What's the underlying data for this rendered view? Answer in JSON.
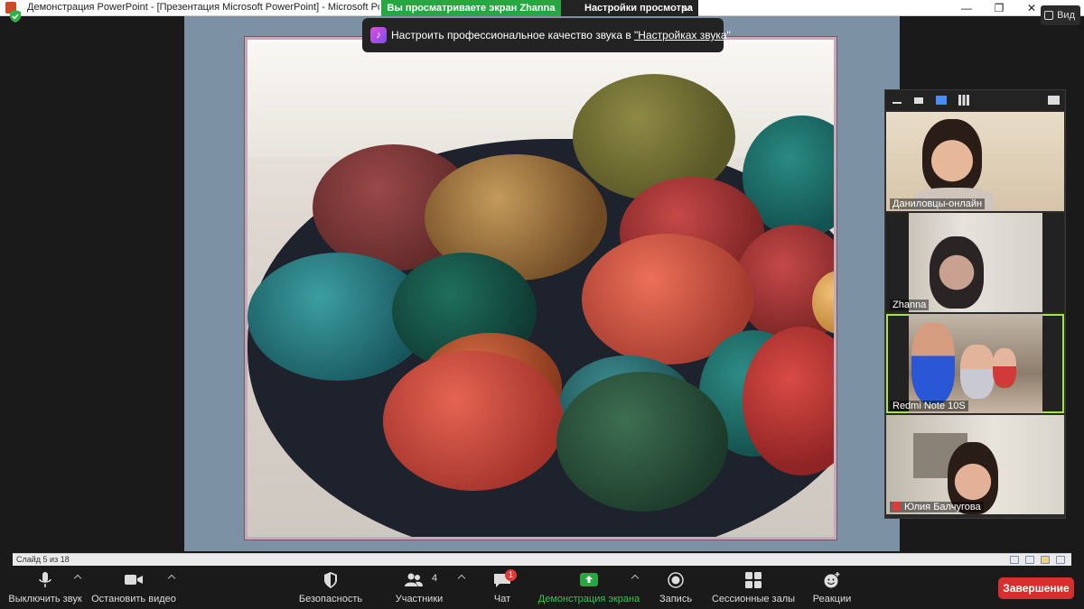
{
  "window": {
    "title": "Демонстрация PowerPoint - [Презентация Microsoft PowerPoint] - Microsoft PowerPoint (Сбой",
    "view_label": "Вид",
    "minimize": "—",
    "restore": "❐",
    "close": "✕"
  },
  "share_bar": {
    "viewing_text": "Вы просматриваете экран Zhanna",
    "view_options_label": "Настройки просмотра"
  },
  "audio_tip": {
    "text": "Настроить профессиональное качество звука в ",
    "link": "\"Настройках звука\""
  },
  "ppt_status": {
    "slide_counter": "Слайд 5 из 18"
  },
  "participants": [
    {
      "name": "Даниловцы-онлайн",
      "muted": false,
      "active": false
    },
    {
      "name": "Zhanna",
      "muted": false,
      "active": false
    },
    {
      "name": "Redmi Note 10S",
      "muted": false,
      "active": true
    },
    {
      "name": "Юлия Балчугова",
      "muted": true,
      "active": false
    }
  ],
  "toolbar": {
    "mute_label": "Выключить звук",
    "video_label": "Остановить видео",
    "security_label": "Безопасность",
    "participants_label": "Участники",
    "participants_count": "4",
    "chat_label": "Чат",
    "chat_badge": "1",
    "share_label": "Демонстрация экрана",
    "record_label": "Запись",
    "breakout_label": "Сессионные залы",
    "reactions_label": "Реакции",
    "end_label": "Завершение"
  },
  "colors": {
    "share_green": "#26a742",
    "end_red": "#d92e2e",
    "active_outline": "#a7e34a"
  }
}
